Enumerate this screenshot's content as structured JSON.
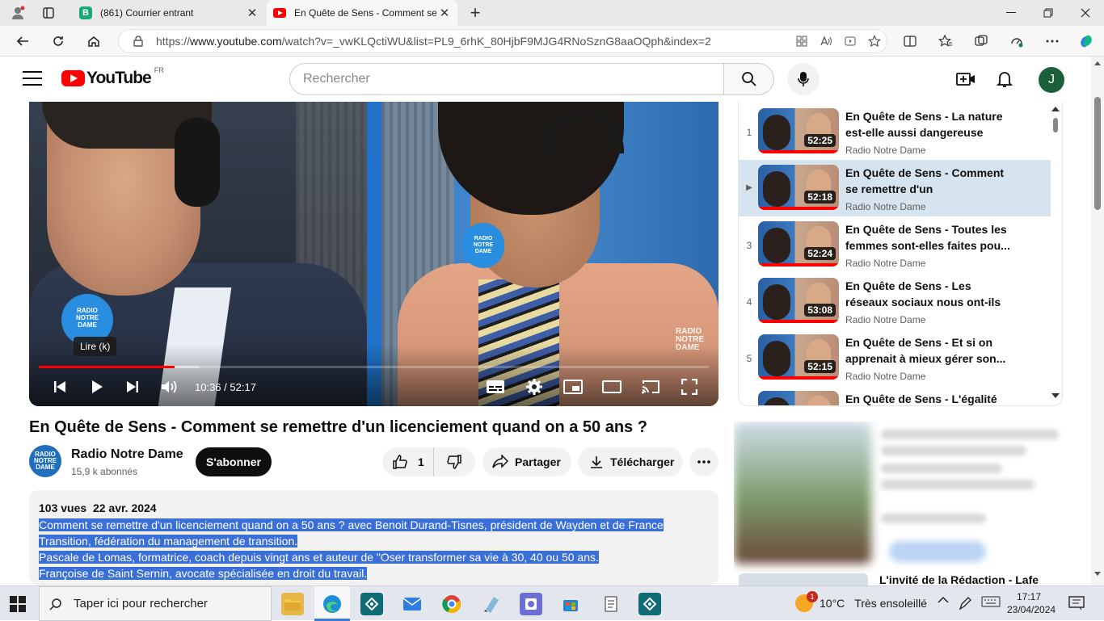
{
  "browser": {
    "tabs": [
      {
        "title": "(861) Courrier entrant",
        "favicon": "b-mail-icon"
      },
      {
        "title": "En Quête de Sens - Comment se",
        "favicon": "youtube-icon",
        "active": true
      }
    ],
    "new_tab": "+",
    "close_glyph": "✕",
    "url_prefix": "https://",
    "url_host": "www.youtube.com",
    "url_path": "/watch?v=_vwKLQctiWU&list=PL9_6rhK_80HjbF9MJG4RNoSznG8aaOQph&index=2"
  },
  "masthead": {
    "logo_word": "YouTube",
    "region": "FR",
    "search_placeholder": "Rechercher",
    "avatar_initial": "J"
  },
  "player": {
    "tooltip": "Lire (k)",
    "current_time": "10:36",
    "duration": "52:17",
    "time_text": "10:36 / 52:17",
    "progress_fraction": 0.203,
    "buffer_fraction": 0.24,
    "mic_label": "RADIO NOTRE DAME",
    "watermark": "RADIO NOTRE DAME"
  },
  "video": {
    "title": "En Quête de Sens - Comment se remettre d'un licenciement quand on a 50 ans ?",
    "channel": "Radio Notre Dame",
    "channel_avatar_text": "RADIO NOTRE DAME",
    "subscribers": "15,9 k abonnés",
    "subscribe_label": "S'abonner",
    "likes": "1",
    "share_label": "Partager",
    "download_label": "Télécharger",
    "views": "103 vues",
    "date": "22 avr. 2024",
    "description": [
      "Comment se remettre d'un licenciement quand on a 50 ans ?  avec Benoit Durand-Tisnes, président de Wayden et de France",
      "Transition, fédération du management de transition.",
      "Pascale de Lomas, formatrice, coach depuis vingt ans et auteur de \"Oser transformer sa vie à 30, 40 ou 50 ans.",
      "Françoise de Saint Sernin, avocate spécialisée en droit du travail."
    ]
  },
  "playlist": {
    "items": [
      {
        "index": "1",
        "title": "En Quête de Sens - La nature est-elle aussi dangereuse qu'...",
        "channel": "Radio Notre Dame",
        "duration": "52:25"
      },
      {
        "index": "▶",
        "title": "En Quête de Sens - Comment se remettre d'un licenciement...",
        "channel": "Radio Notre Dame",
        "duration": "52:18",
        "active": true
      },
      {
        "index": "3",
        "title": "En Quête de Sens - Toutes les femmes sont-elles faites pou...",
        "channel": "Radio Notre Dame",
        "duration": "52:24"
      },
      {
        "index": "4",
        "title": "En Quête de Sens - Les réseaux sociaux nous ont-ils rendus...",
        "channel": "Radio Notre Dame",
        "duration": "53:08"
      },
      {
        "index": "5",
        "title": "En Quête de Sens - Et si on apprenait à mieux gérer son...",
        "channel": "Radio Notre Dame",
        "duration": "52:15"
      },
      {
        "index": "",
        "title": "En Quête de Sens - L'égalité",
        "channel": "",
        "duration": ""
      }
    ]
  },
  "recommendations": {
    "partial_title": "L'invité de la Rédaction - Lafe"
  },
  "taskbar": {
    "search_placeholder": "Taper ici pour rechercher",
    "weather_temp": "10°C",
    "weather_text": "Très ensoleillé",
    "weather_badge": "1",
    "time": "17:17",
    "date": "23/04/2024"
  },
  "colors": {
    "yt_red": "#ff0000",
    "highlight": "#3b6fd8",
    "active_playlist_bg": "#d6e4f0"
  }
}
